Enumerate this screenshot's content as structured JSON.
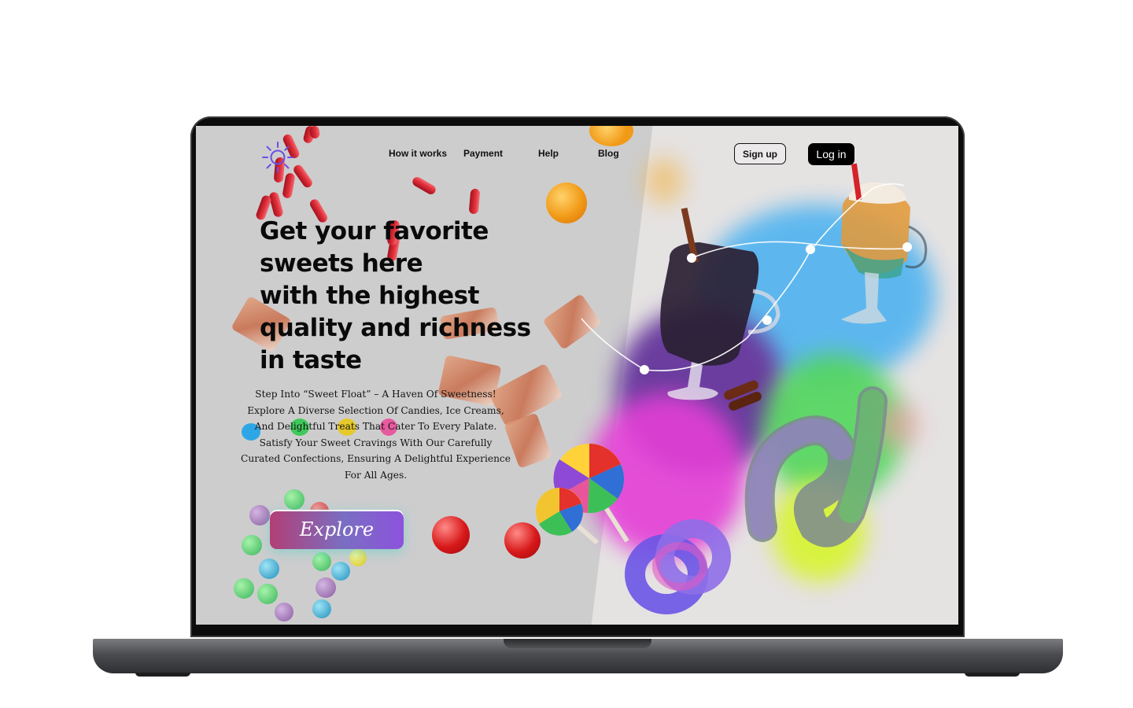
{
  "nav": {
    "logo": "sun-icon",
    "links": [
      "How it works",
      "Payment",
      "Help",
      "Blog"
    ],
    "signup_label": "Sign up",
    "login_label": "Log in"
  },
  "hero": {
    "title_lines": [
      "Get your favorite",
      "sweets here",
      "with the highest",
      "quality and richness",
      "in taste"
    ],
    "description": "Step Into “Sweet Float” – A Haven Of Sweetness! Explore A Diverse Selection Of Candies, Ice Creams, And Delightful Treats That Cater To Every Palate. Satisfy Your Sweet Cravings With Our Carefully Curated Confections, Ensuring A Delightful Experience For All Ages.",
    "cta_label": "Explore"
  },
  "colors": {
    "brand_logo": "#6b4de6",
    "login_bg": "#000000",
    "blob_blue": "#4fb3f0",
    "blob_purple": "#6a3d9e",
    "blob_pink": "#e43fd6",
    "blob_green": "#52d65c",
    "blob_yellow": "#d8f240"
  }
}
